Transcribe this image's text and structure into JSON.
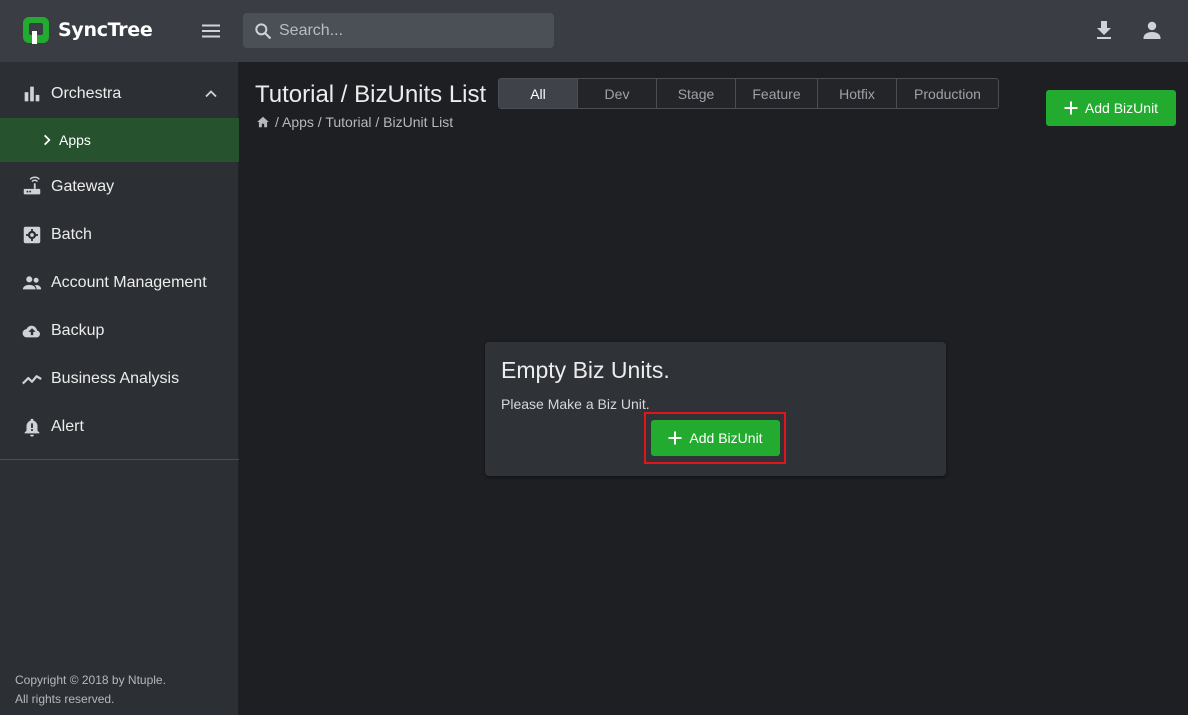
{
  "app": {
    "name": "SyncTree",
    "brand_color": "#22ab2e"
  },
  "topbar": {
    "search_placeholder": "Search...",
    "icons": [
      "menu-icon",
      "search-icon",
      "download-icon",
      "user-icon"
    ]
  },
  "sidebar": {
    "items": [
      {
        "label": "Orchestra",
        "icon": "bar-chart-icon",
        "expanded": true
      },
      {
        "label": "Gateway",
        "icon": "router-icon"
      },
      {
        "label": "Batch",
        "icon": "gear-box-icon"
      },
      {
        "label": "Account Management",
        "icon": "people-icon"
      },
      {
        "label": "Backup",
        "icon": "cloud-upload-icon"
      },
      {
        "label": "Business Analysis",
        "icon": "trend-line-icon"
      },
      {
        "label": "Alert",
        "icon": "bell-alert-icon"
      }
    ],
    "sub_items": [
      {
        "label": "Apps",
        "active": true
      }
    ],
    "copyright_line1": "Copyright © 2018 by Ntuple.",
    "copyright_line2": "All rights reserved."
  },
  "main": {
    "title": "Tutorial / BizUnits List",
    "breadcrumb": " / Apps / Tutorial / BizUnit List",
    "tabs": [
      {
        "label": "All",
        "active": true
      },
      {
        "label": "Dev"
      },
      {
        "label": "Stage"
      },
      {
        "label": "Feature"
      },
      {
        "label": "Hotfix"
      },
      {
        "label": "Production"
      }
    ],
    "add_button_label": "Add BizUnit"
  },
  "empty_card": {
    "title": "Empty Biz Units.",
    "message": "Please Make a Biz Unit.",
    "button_label": "Add BizUnit"
  }
}
